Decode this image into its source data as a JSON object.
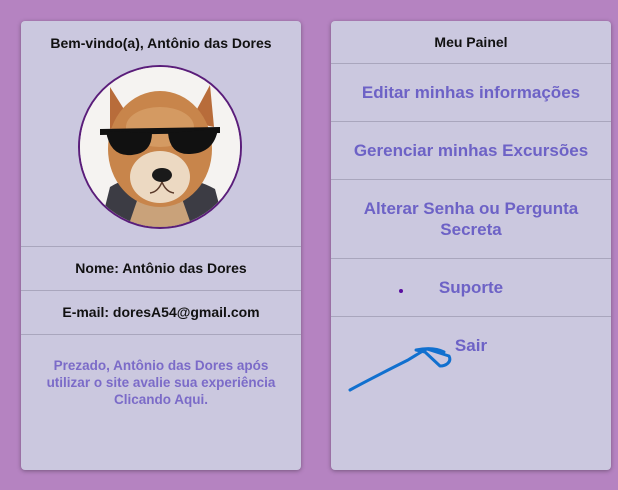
{
  "profile": {
    "welcome": "Bem-vindo(a), Antônio das Dores",
    "avatar_alt": "avatar",
    "name_line": "Nome: Antônio das Dores",
    "email_line": "E-mail: doresA54@gmail.com",
    "feedback": "Prezado, Antônio das Dores após utilizar o site avalie sua experiência Clicando Aqui."
  },
  "menu": {
    "title": "Meu Painel",
    "items": [
      {
        "label": "Editar minhas informações"
      },
      {
        "label": "Gerenciar minhas Excursões"
      },
      {
        "label": "Alterar Senha ou Pergunta Secreta"
      },
      {
        "label": "Suporte"
      },
      {
        "label": "Sair"
      }
    ]
  },
  "colors": {
    "background": "#b583c1",
    "card": "#cbc8df",
    "link": "#6d62c6",
    "annotation": "#1170cf"
  }
}
